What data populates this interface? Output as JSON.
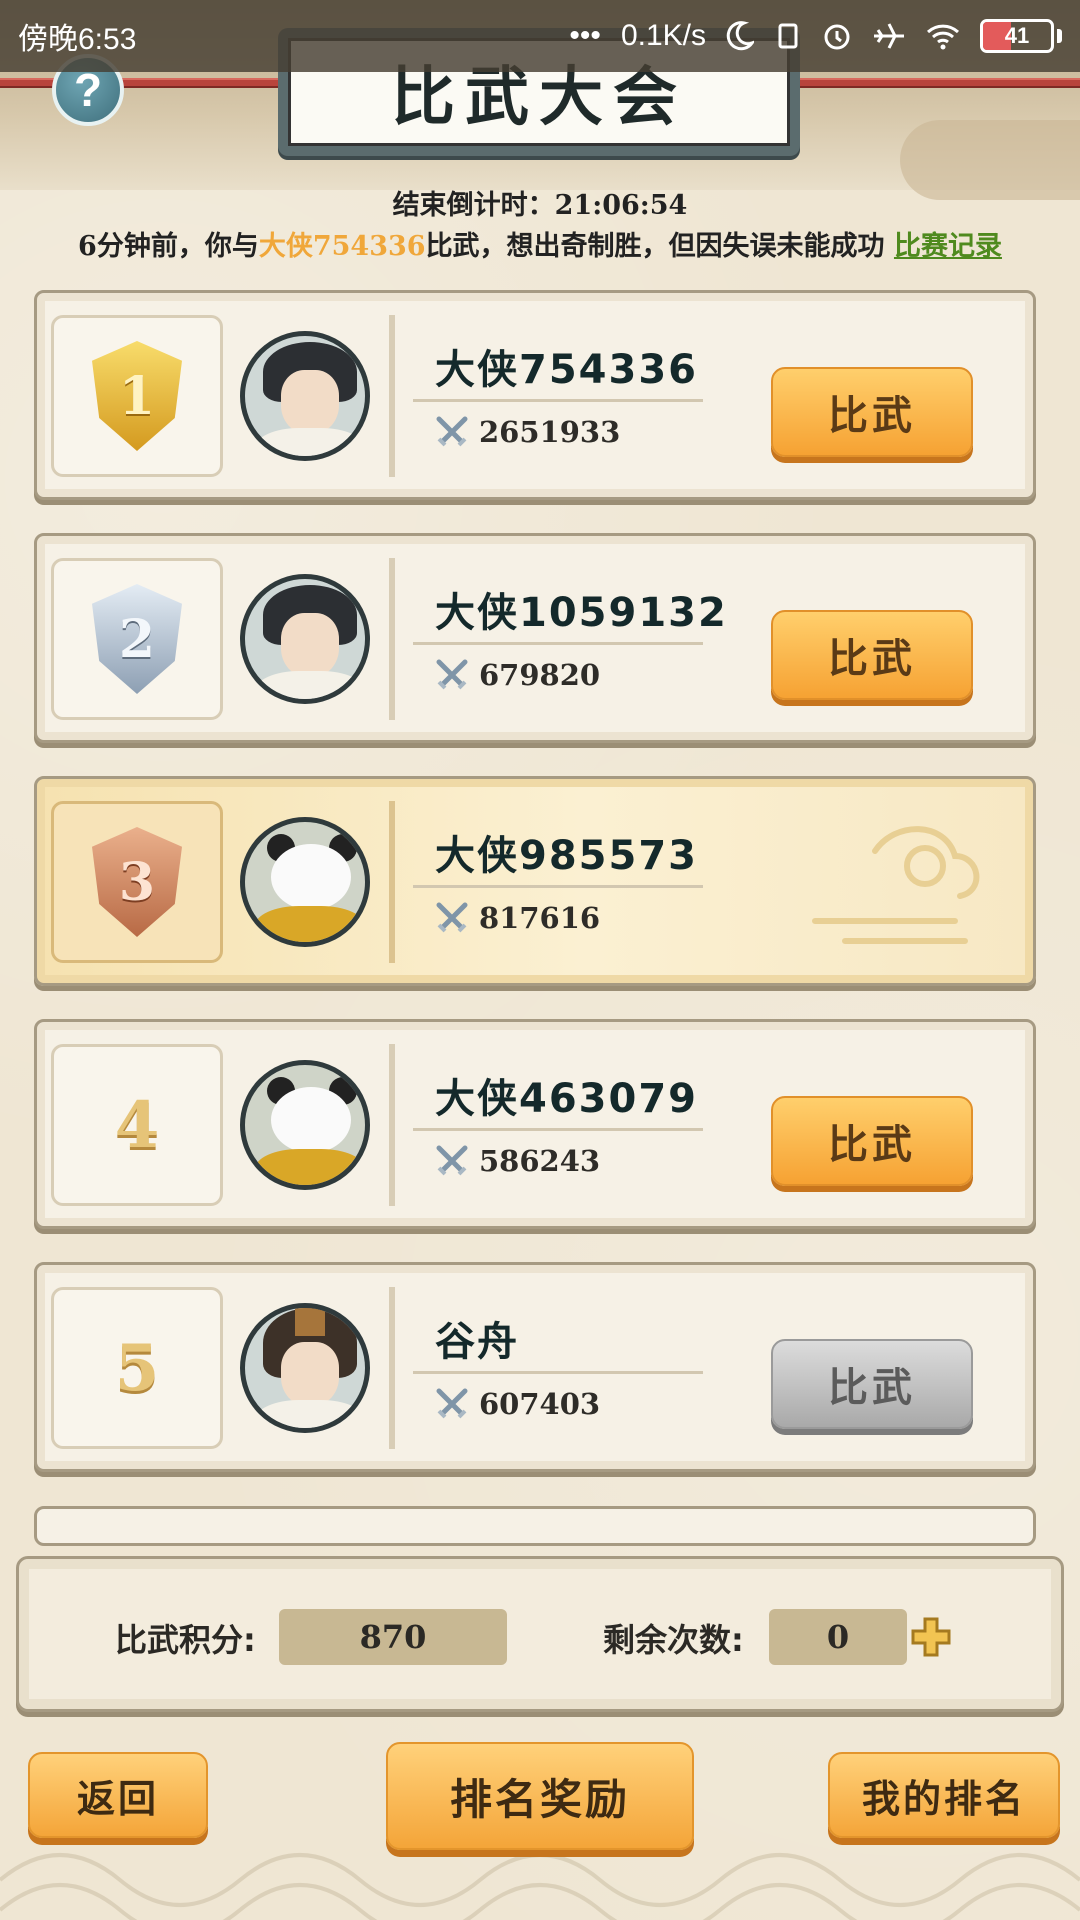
{
  "status_bar": {
    "time": "傍晚6:53",
    "net_speed": "0.1K/s",
    "battery": "41"
  },
  "header": {
    "title": "比武大会",
    "help": "?"
  },
  "countdown": {
    "label": "结束倒计时：",
    "value": "21:06:54"
  },
  "notice": {
    "prefix": "6分钟前，你与",
    "opponent": "大侠754336",
    "suffix": "比武，想出奇制胜，但因失误未能成功",
    "link": "比赛记录"
  },
  "ranks": [
    {
      "rank": "1",
      "name": "大侠754336",
      "power": "2651933",
      "button": "比武",
      "button_state": "active",
      "avatar": "swordsman"
    },
    {
      "rank": "2",
      "name": "大侠1059132",
      "power": "679820",
      "button": "比武",
      "button_state": "active",
      "avatar": "swordsman"
    },
    {
      "rank": "3",
      "name": "大侠985573",
      "power": "817616",
      "button": "",
      "button_state": "none",
      "avatar": "panda"
    },
    {
      "rank": "4",
      "name": "大侠463079",
      "power": "586243",
      "button": "比武",
      "button_state": "active",
      "avatar": "panda"
    },
    {
      "rank": "5",
      "name": "谷舟",
      "power": "607403",
      "button": "比武",
      "button_state": "disabled",
      "avatar": "swordsman-hat"
    }
  ],
  "score_panel": {
    "points_label": "比武积分:",
    "points_value": "870",
    "remaining_label": "剩余次数:",
    "remaining_value": "0"
  },
  "bottom": {
    "back": "返回",
    "rewards": "排名奖励",
    "my_rank": "我的排名"
  },
  "colors": {
    "accent_orange": "#f6a233",
    "highlight_text": "#f0a73a",
    "link_green": "#4f8a1e"
  }
}
